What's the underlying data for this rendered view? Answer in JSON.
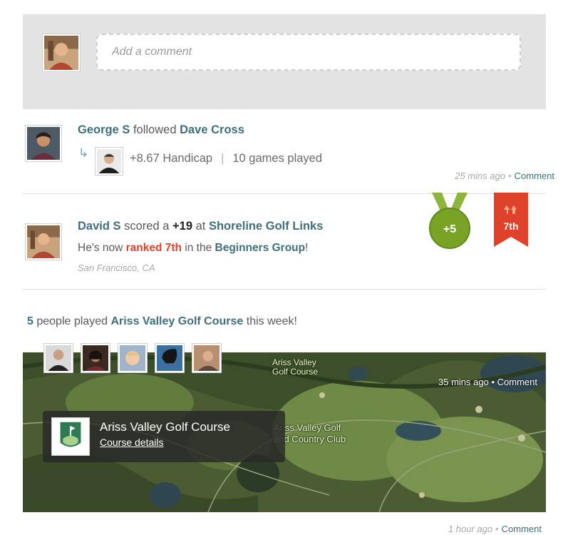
{
  "composer": {
    "placeholder": "Add a comment",
    "avatar_icon": "user-avatar-icon"
  },
  "feed": [
    {
      "actor": "George S",
      "verb": "followed",
      "target": "Dave Cross",
      "detail_handicap": "+8.67 Handicap",
      "detail_separator": "|",
      "detail_games": "10 games played",
      "time": "25 mins ago",
      "dot": "•",
      "comment_label": "Comment"
    },
    {
      "actor": "David S",
      "verb": "scored a",
      "score": "+19",
      "prep": "at",
      "course": "Shoreline Golf Links",
      "line2_prefix": "He's now",
      "rank_text": "ranked 7th",
      "line2_mid": "in the",
      "group": "Beginners Group",
      "line2_suffix": "!",
      "location": "San Francisco, CA",
      "medal_label": "+5",
      "rank_badge_label": "7th",
      "medal_color": "#7aa326",
      "rank_badge_color": "#e0412a"
    },
    {
      "count": "5",
      "text_mid": "people played",
      "course": "Ariss Valley Golf Course",
      "text_suffix": "this week!",
      "map_label_1": "Ariss Valley",
      "map_label_2": "Golf Course",
      "map_label_3": "Ariss Valley Golf",
      "map_label_4": "and Country Club",
      "card_title": "Ariss Valley Golf Course",
      "card_link": "Course details",
      "time_map": "35 mins ago",
      "dot": "•",
      "comment_label": "Comment"
    }
  ],
  "footer_meta": {
    "time": "1 hour ago",
    "dot": "•",
    "comment_label": "Comment"
  },
  "colors": {
    "link": "#3f6f7a",
    "accent_red": "#e0412a",
    "panel_bg": "#e3e3e3"
  }
}
